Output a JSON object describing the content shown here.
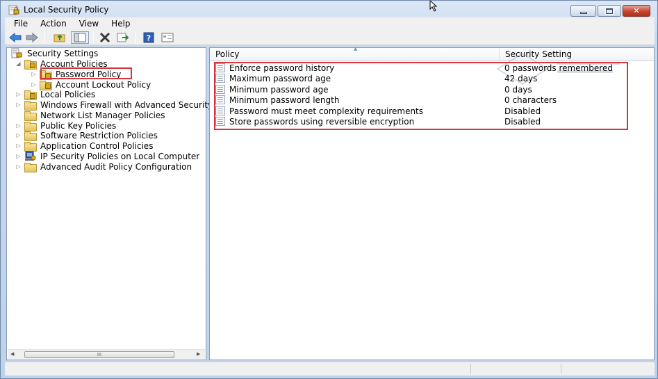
{
  "window": {
    "title": "Local Security Policy"
  },
  "menu": {
    "items": [
      "File",
      "Action",
      "View",
      "Help"
    ]
  },
  "toolbar": {
    "icons": [
      "back-arrow-icon",
      "forward-arrow-icon",
      "up-folder-icon",
      "show-hide-tree-icon",
      "delete-icon",
      "export-list-icon",
      "help-icon",
      "properties-icon"
    ]
  },
  "tree": {
    "root": "Security Settings",
    "account_policies": "Account Policies",
    "password_policy": "Password Policy",
    "account_lockout_policy": "Account Lockout Policy",
    "local_policies": "Local Policies",
    "windows_firewall": "Windows Firewall with Advanced Security",
    "network_list": "Network List Manager Policies",
    "public_key": "Public Key Policies",
    "software_restriction": "Software Restriction Policies",
    "application_control": "Application Control Policies",
    "ip_security": "IP Security Policies on Local Computer",
    "advanced_audit": "Advanced Audit Policy Configuration",
    "scrollbar_grip": "III"
  },
  "list": {
    "header_policy": "Policy",
    "header_setting": "Security Setting",
    "rows": [
      {
        "policy": "Enforce password history",
        "setting": "0 passwords remembered"
      },
      {
        "policy": "Maximum password age",
        "setting": "42 days"
      },
      {
        "policy": "Minimum password age",
        "setting": "0 days"
      },
      {
        "policy": "Minimum password length",
        "setting": "0 characters"
      },
      {
        "policy": "Password must meet complexity requirements",
        "setting": "Disabled"
      },
      {
        "policy": "Store passwords using reversible encryption",
        "setting": "Disabled"
      }
    ]
  },
  "colors": {
    "highlight_box": "#d9333a",
    "titlebar": "#c6d8ee",
    "close_button": "#c7452f"
  }
}
